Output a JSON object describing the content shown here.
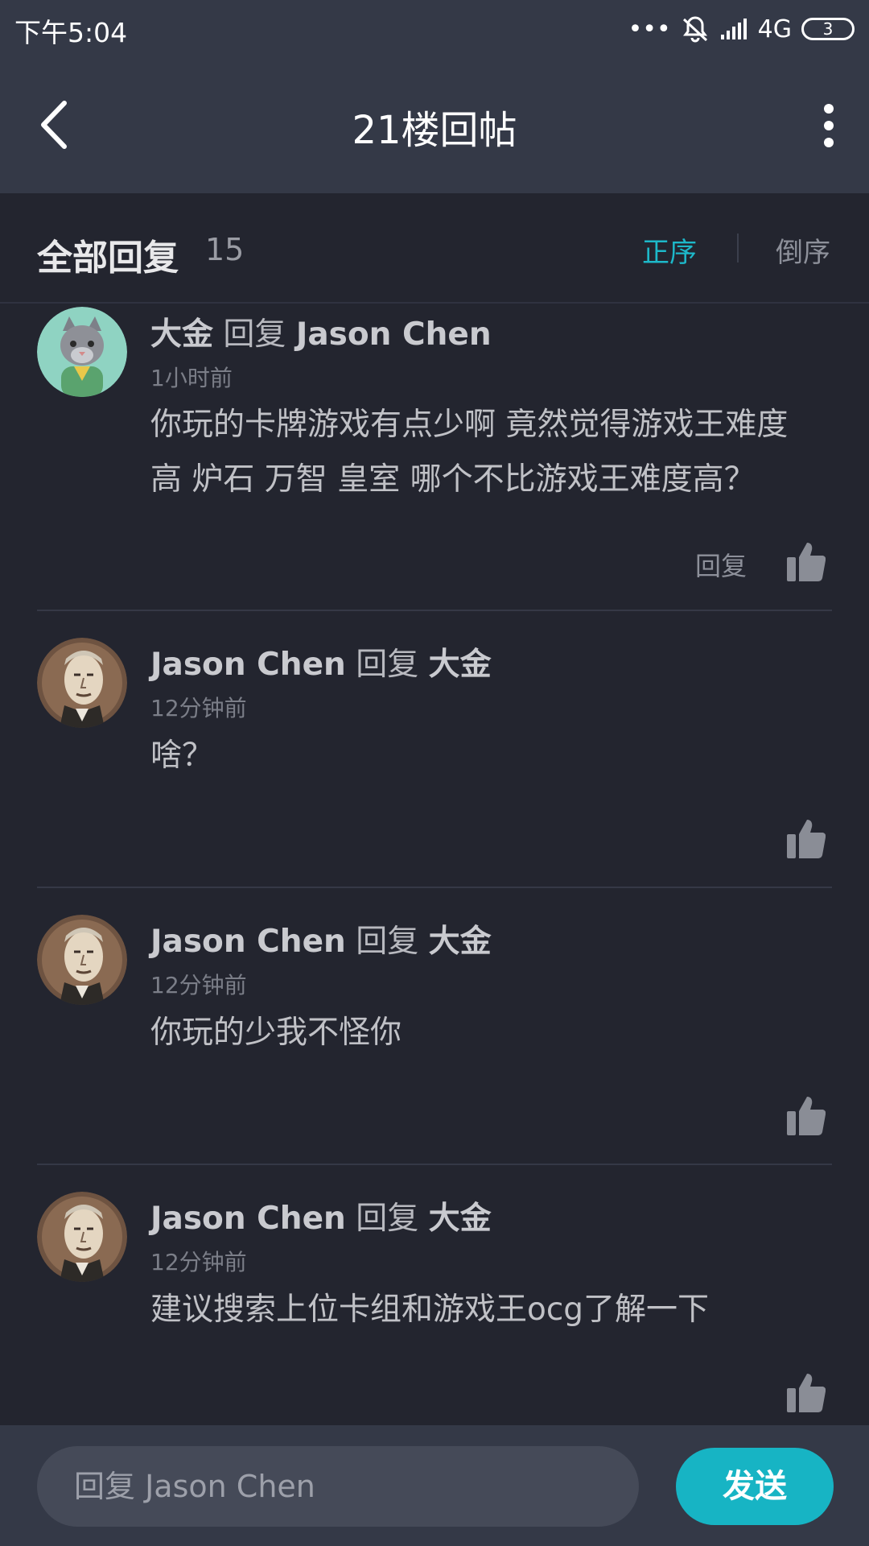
{
  "status_bar": {
    "time": "下午5:04",
    "signal_dots": "•••",
    "network": "4G",
    "battery": "3",
    "icons": [
      "mute-bell-icon",
      "signal-icon",
      "battery-icon"
    ]
  },
  "nav": {
    "title": "21楼回帖",
    "back_icon": "chevron-left-icon",
    "more_icon": "more-vertical-icon"
  },
  "subheader": {
    "title": "全部回复",
    "count": "15",
    "sort_asc": "正序",
    "sort_desc": "倒序"
  },
  "comments": [
    {
      "author": "大金",
      "reply_word": "回复",
      "target": "Jason Chen",
      "time": "1小时前",
      "text": "你玩的卡牌游戏有点少啊   竟然觉得游戏王难度高  炉石 万智 皇室 哪个不比游戏王难度高？",
      "reply_label": "回复",
      "avatar": "cat-avatar"
    },
    {
      "author": "Jason Chen",
      "reply_word": "回复",
      "target": "大金",
      "time": "12分钟前",
      "text": "啥？",
      "avatar": "old-man-avatar"
    },
    {
      "author": "Jason Chen",
      "reply_word": "回复",
      "target": "大金",
      "time": "12分钟前",
      "text": "你玩的少我不怪你",
      "avatar": "old-man-avatar"
    },
    {
      "author": "Jason Chen",
      "reply_word": "回复",
      "target": "大金",
      "time": "12分钟前",
      "text": "建议搜索上位卡组和游戏王ocg了解一下",
      "avatar": "old-man-avatar"
    }
  ],
  "composer": {
    "placeholder": "回复 Jason Chen",
    "send_label": "发送"
  },
  "colors": {
    "background": "#23252f",
    "header": "#343947",
    "accent": "#17b4c4"
  }
}
